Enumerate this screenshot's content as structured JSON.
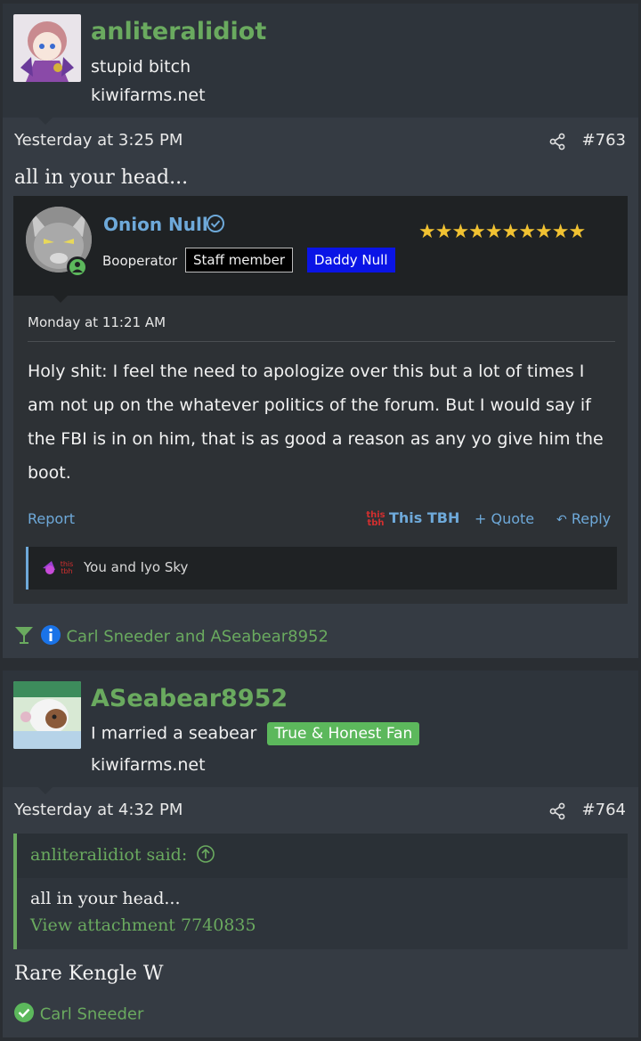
{
  "posts": [
    {
      "username": "anliteralidiot",
      "user_title": "stupid bitch",
      "user_extra": "kiwifarms.net",
      "timestamp": "Yesterday at 3:25 PM",
      "post_number": "#763",
      "body": "all in your head...",
      "embedded_post": {
        "username": "Onion Null",
        "role": "Booperator",
        "badges": [
          "Staff member",
          "Daddy Null"
        ],
        "stars": "★★★★★★★★★★",
        "date": "Monday at 11:21 AM",
        "text": "Holy shit: I feel the need to apologize over this but a lot of times I am not up on the whatever politics of the forum. But I would say if the FBI is in on him, that is as good a reason as any yo give him the boot.",
        "actions": {
          "report": "Report",
          "tbh": "This TBH",
          "quote": "+ Quote",
          "reply": "Reply"
        },
        "tbh_logo": "this tbh",
        "reactions": "You and Iyo Sky"
      },
      "reactions": "Carl Sneeder and ASeabear8952"
    },
    {
      "username": "ASeabear8952",
      "user_title": "I married a seabear",
      "user_badge": "True & Honest Fan",
      "user_extra": "kiwifarms.net",
      "timestamp": "Yesterday at 4:32 PM",
      "post_number": "#764",
      "quote": {
        "attribution": "anliteralidiot said:",
        "text": "all in your head...",
        "link": "View attachment 7740835"
      },
      "body": "Rare Kengle W",
      "reactions": "Carl Sneeder"
    }
  ],
  "colors": {
    "username": "#6aaa5f",
    "link_blue": "#6ea9d9",
    "star_gold": "#f1c232",
    "badge_green": "#5cb85c",
    "daddy_blue": "#0a14e6"
  }
}
